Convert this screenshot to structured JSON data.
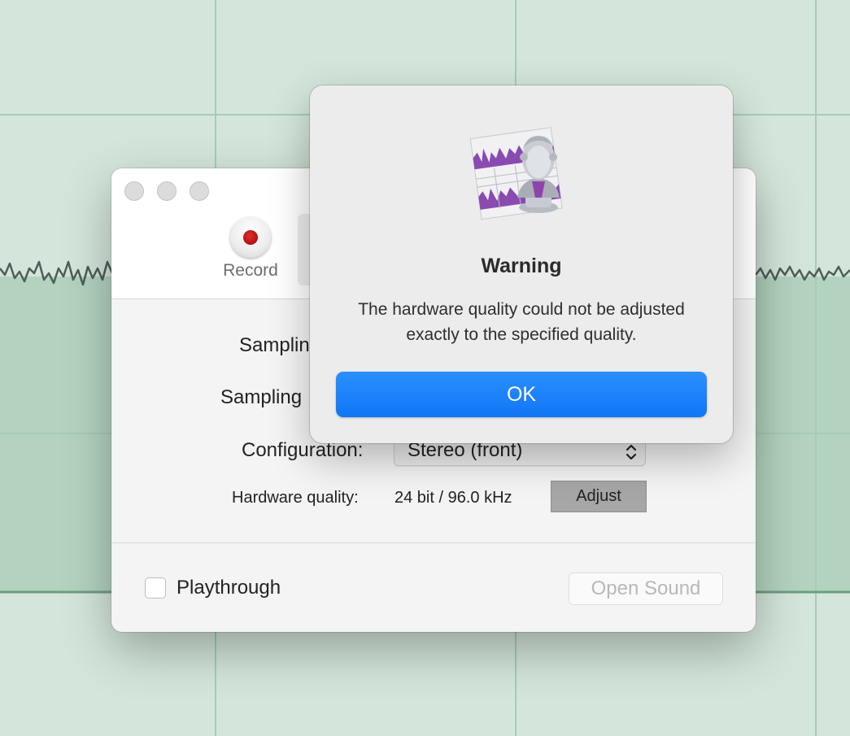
{
  "recorder_window": {
    "record_label": "Record",
    "sampling_rate_label": "Samplin",
    "sampling_size_label": "Sampling",
    "configuration_label": "Configuration:",
    "configuration_value": "Stereo (front)",
    "hardware_quality_label": "Hardware quality:",
    "hardware_quality_value": "24 bit / 96.0 kHz",
    "adjust_label": "Adjust",
    "playthrough_label": "Playthrough",
    "playthrough_checked": false,
    "open_sound_label": "Open Sound"
  },
  "alert": {
    "app_icon": "audio-app-icon",
    "title": "Warning",
    "message": "The hardware quality could not be adjusted exactly to the specified quality.",
    "ok_label": "OK"
  },
  "colors": {
    "background": "#d4e6db",
    "waveform_fill": "#b3d3bf",
    "accent_blue": "#1a7ffa",
    "record_red": "#c41212"
  }
}
